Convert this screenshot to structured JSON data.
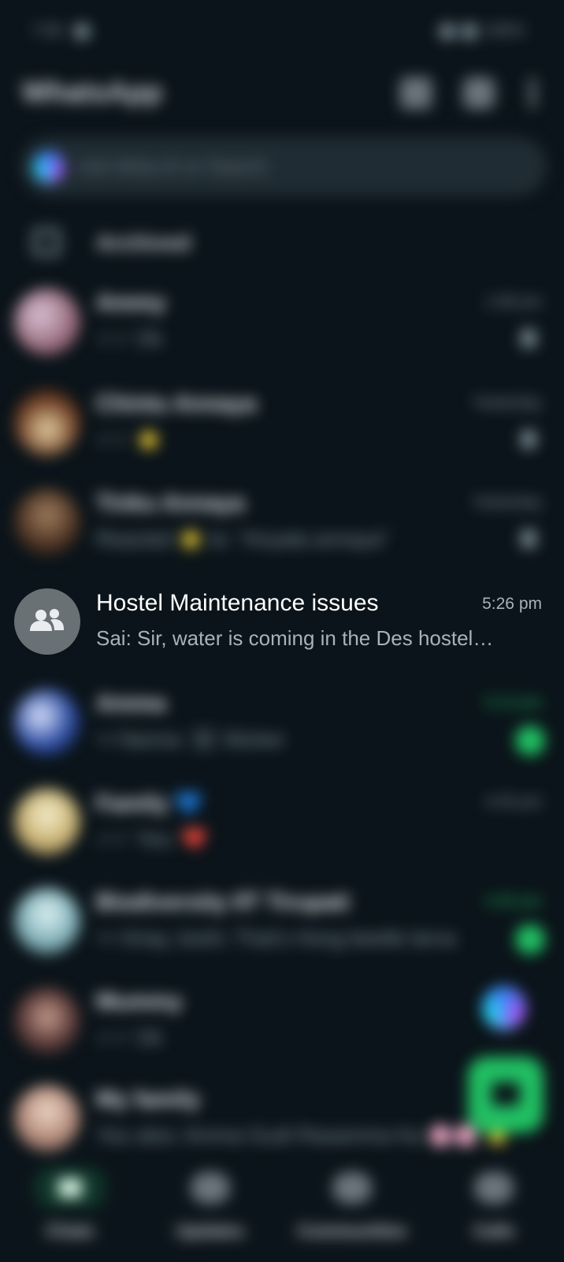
{
  "status_bar": {
    "time": "7:06",
    "battery": "100%"
  },
  "header": {
    "title": "WhatsApp"
  },
  "search": {
    "placeholder": "Ask Meta AI or Search"
  },
  "archived": {
    "label": "Archived"
  },
  "chats": [
    {
      "name": "Ammy",
      "preview": "✓✓ Ok",
      "time": "1:08 pm"
    },
    {
      "name": "Chintu Annaya",
      "preview": "✓✓ ⭐",
      "time": "Yesterday"
    },
    {
      "name": "Tinku Annaya",
      "preview": "Reacted ⭐ to: \"Anyata annaya\"",
      "time": "Yesterday"
    },
    {
      "name": "Hostel Maintenance issues",
      "preview": "Sai: Sir, water is coming in the Des hostel…",
      "time": "5:26 pm"
    },
    {
      "name": "Amma",
      "preview": "↪ Nanna: 🖼 Sticker",
      "time": "5:13 pm"
    },
    {
      "name": "Family 💙",
      "preview": "✓✓ You: ❤️",
      "time": "4:45 pm"
    },
    {
      "name": "Biodiversity IIT Tirupati",
      "preview": "↪ Vinay Joshi: That's Hong beetle larva",
      "time": "4:35 pm"
    },
    {
      "name": "Mummy",
      "preview": "✓✓ Ok",
      "time": ""
    },
    {
      "name": "My family",
      "preview": "You also: Amma Gudi Rasamma Ka 🌸🌸 ⭐",
      "time": ""
    }
  ],
  "bottom_nav": {
    "chats": "Chats",
    "updates": "Updates",
    "communities": "Communities",
    "calls": "Calls"
  }
}
